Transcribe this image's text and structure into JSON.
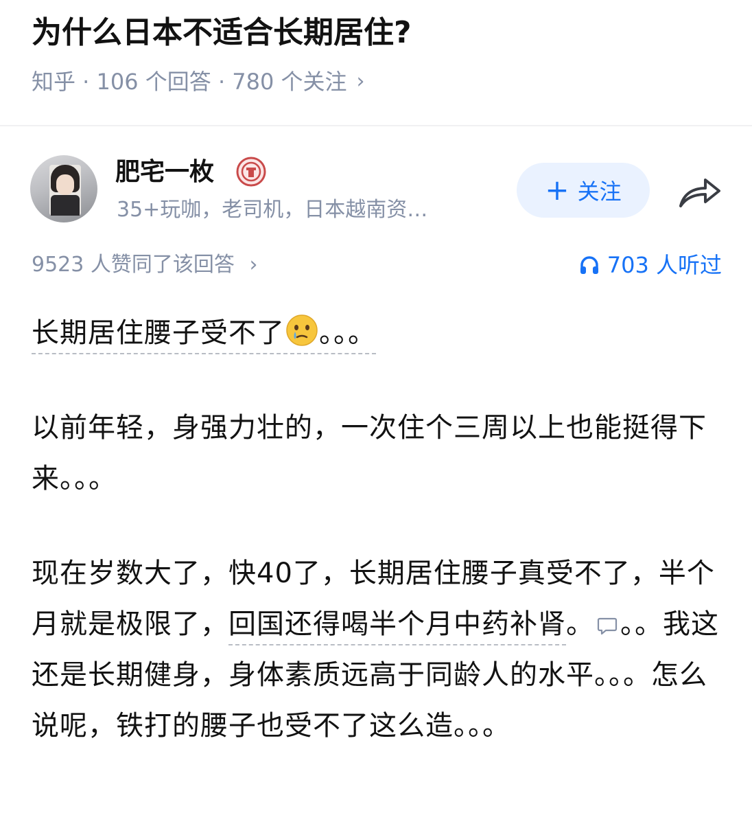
{
  "question": {
    "title": "为什么日本不适合长期居住?",
    "meta": "知乎 · 106 个回答 · 780 个关注",
    "meta_chevron": "›"
  },
  "author": {
    "name": "肥宅一枚",
    "description": "35+玩咖，老司机，日本越南资…",
    "follow_label": "关注",
    "follow_icon": "+",
    "share_icon": "share-arrow-icon",
    "badge_icon": "badge-icon"
  },
  "stats": {
    "votes": "9523 人赞同了该回答",
    "votes_chevron": "›",
    "listened": "703 人听过"
  },
  "content": {
    "p1_text": "长期居住腰子受不了",
    "p1_tail": "。。。",
    "p2": "以前年轻，身强力壮的，一次住个三周以上也能挺得下来。。。",
    "p3_a": "现在岁数大了，快40了，长期居住腰子真受不了，半个月就是极限了，",
    "p3_link": "回国还得喝半个月中药补肾",
    "p3_b": "。",
    "p3_c": "。。我这还是长期健身，身体素质远高于同龄人的水平。。。怎么说呢，铁打的腰子也受不了这么造。。。"
  },
  "colors": {
    "accent": "#1772f6",
    "follow_bg": "#eaf2ff",
    "meta_gray": "#8590a6",
    "text": "#121212"
  }
}
